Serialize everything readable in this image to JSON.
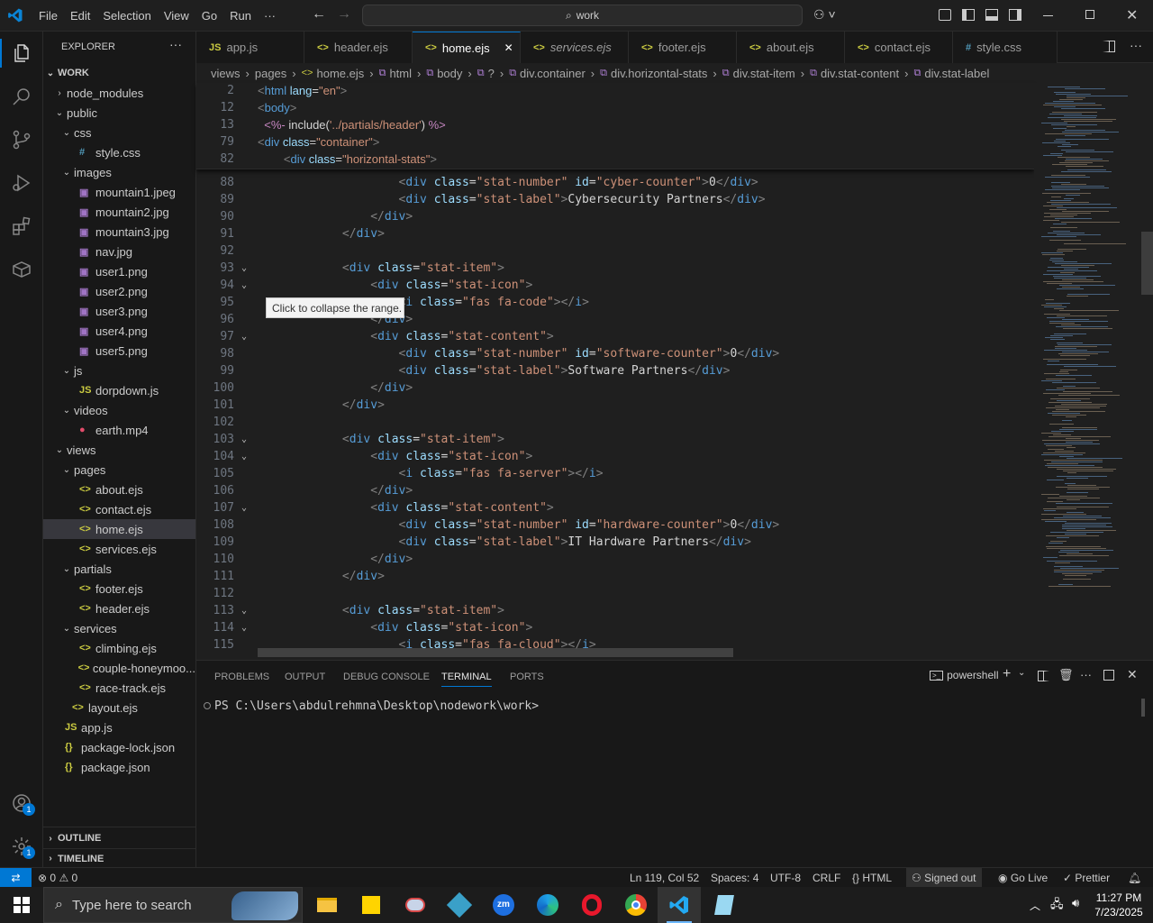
{
  "titlebar": {
    "menu": [
      "File",
      "Edit",
      "Selection",
      "View",
      "Go",
      "Run",
      "···"
    ],
    "search": "work"
  },
  "sidebar": {
    "title": "EXPLORER",
    "more": "···",
    "root": "WORK",
    "tree": [
      {
        "label": "node_modules",
        "indent": 1,
        "type": "folder",
        "open": false
      },
      {
        "label": "public",
        "indent": 1,
        "type": "folder",
        "open": true
      },
      {
        "label": "css",
        "indent": 2,
        "type": "folder",
        "open": true
      },
      {
        "label": "style.css",
        "indent": 3,
        "type": "css"
      },
      {
        "label": "images",
        "indent": 2,
        "type": "folder",
        "open": true
      },
      {
        "label": "mountain1.jpeg",
        "indent": 3,
        "type": "img"
      },
      {
        "label": "mountain2.jpg",
        "indent": 3,
        "type": "img"
      },
      {
        "label": "mountain3.jpg",
        "indent": 3,
        "type": "img"
      },
      {
        "label": "nav.jpg",
        "indent": 3,
        "type": "img"
      },
      {
        "label": "user1.png",
        "indent": 3,
        "type": "img"
      },
      {
        "label": "user2.png",
        "indent": 3,
        "type": "img"
      },
      {
        "label": "user3.png",
        "indent": 3,
        "type": "img"
      },
      {
        "label": "user4.png",
        "indent": 3,
        "type": "img"
      },
      {
        "label": "user5.png",
        "indent": 3,
        "type": "img"
      },
      {
        "label": "js",
        "indent": 2,
        "type": "folder",
        "open": true
      },
      {
        "label": "dorpdown.js",
        "indent": 3,
        "type": "js"
      },
      {
        "label": "videos",
        "indent": 2,
        "type": "folder",
        "open": true
      },
      {
        "label": "earth.mp4",
        "indent": 3,
        "type": "vid"
      },
      {
        "label": "views",
        "indent": 1,
        "type": "folder",
        "open": true
      },
      {
        "label": "pages",
        "indent": 2,
        "type": "folder",
        "open": true
      },
      {
        "label": "about.ejs",
        "indent": 3,
        "type": "ejs"
      },
      {
        "label": "contact.ejs",
        "indent": 3,
        "type": "ejs"
      },
      {
        "label": "home.ejs",
        "indent": 3,
        "type": "ejs",
        "selected": true
      },
      {
        "label": "services.ejs",
        "indent": 3,
        "type": "ejs"
      },
      {
        "label": "partials",
        "indent": 2,
        "type": "folder",
        "open": true
      },
      {
        "label": "footer.ejs",
        "indent": 3,
        "type": "ejs"
      },
      {
        "label": "header.ejs",
        "indent": 3,
        "type": "ejs"
      },
      {
        "label": "services",
        "indent": 2,
        "type": "folder",
        "open": true
      },
      {
        "label": "climbing.ejs",
        "indent": 3,
        "type": "ejs"
      },
      {
        "label": "couple-honeymoo...",
        "indent": 3,
        "type": "ejs"
      },
      {
        "label": "race-track.ejs",
        "indent": 3,
        "type": "ejs"
      },
      {
        "label": "layout.ejs",
        "indent": 2,
        "type": "ejs"
      },
      {
        "label": "app.js",
        "indent": 1,
        "type": "js"
      },
      {
        "label": "package-lock.json",
        "indent": 1,
        "type": "json"
      },
      {
        "label": "package.json",
        "indent": 1,
        "type": "json"
      }
    ],
    "outline": "OUTLINE",
    "timeline": "TIMELINE"
  },
  "tabs": [
    {
      "label": "app.js",
      "icon": "JS"
    },
    {
      "label": "header.ejs",
      "icon": "<>"
    },
    {
      "label": "home.ejs",
      "icon": "<>",
      "active": true,
      "close": "✕"
    },
    {
      "label": "services.ejs",
      "icon": "<>"
    },
    {
      "label": "footer.ejs",
      "icon": "<>"
    },
    {
      "label": "about.ejs",
      "icon": "<>"
    },
    {
      "label": "contact.ejs",
      "icon": "<>"
    },
    {
      "label": "style.css",
      "icon": "#"
    }
  ],
  "breadcrumb": [
    "views",
    "pages",
    "home.ejs",
    "html",
    "body",
    "?",
    "div.container",
    "div.horizontal-stats",
    "div.stat-item",
    "div.stat-content",
    "div.stat-label"
  ],
  "sticky": [
    {
      "n": "2",
      "html": "<span class='g'>&lt;</span><span class='t'>html</span> <span class='a'>lang</span>=<span class='s'>\"en\"</span><span class='g'>&gt;</span>"
    },
    {
      "n": "12",
      "html": "<span class='g'>&lt;</span><span class='t'>body</span><span class='g'>&gt;</span>"
    },
    {
      "n": "13",
      "html": "  <span class='e'>&lt;%-</span> include(<span class='s'>'../partials/header'</span>) <span class='e'>%&gt;</span>"
    },
    {
      "n": "79",
      "html": "<span class='g'>&lt;</span><span class='t'>div</span> <span class='a'>class</span>=<span class='s'>\"container\"</span><span class='g'>&gt;</span>"
    },
    {
      "n": "82",
      "html": "        <span class='g'>&lt;</span><span class='t'>div</span> <span class='a'>class</span>=<span class='s'>\"horizontal-stats\"</span><span class='g'>&gt;</span>"
    }
  ],
  "code": [
    {
      "n": "88",
      "html": "                    <span class='g'>&lt;</span><span class='t'>div</span> <span class='a'>class</span>=<span class='s'>\"stat-number\"</span> <span class='a'>id</span>=<span class='s'>\"cyber-counter\"</span><span class='g'>&gt;</span>0<span class='g'>&lt;/</span><span class='t'>div</span><span class='g'>&gt;</span>"
    },
    {
      "n": "89",
      "html": "                    <span class='g'>&lt;</span><span class='t'>div</span> <span class='a'>class</span>=<span class='s'>\"stat-label\"</span><span class='g'>&gt;</span>Cybersecurity Partners<span class='g'>&lt;/</span><span class='t'>div</span><span class='g'>&gt;</span>"
    },
    {
      "n": "90",
      "html": "                <span class='g'>&lt;/</span><span class='t'>div</span><span class='g'>&gt;</span>"
    },
    {
      "n": "91",
      "html": "            <span class='g'>&lt;/</span><span class='t'>div</span><span class='g'>&gt;</span>"
    },
    {
      "n": "92",
      "html": ""
    },
    {
      "n": "93",
      "fold": true,
      "html": "            <span class='g'>&lt;</span><span class='t'>div</span> <span class='a'>class</span>=<span class='s'>\"stat-item\"</span><span class='g'>&gt;</span>"
    },
    {
      "n": "94",
      "fold": true,
      "html": "                <span class='g'>&lt;</span><span class='t'>div</span> <span class='a'>class</span>=<span class='s'>\"stat-icon\"</span><span class='g'>&gt;</span>"
    },
    {
      "n": "95",
      "html": "                    <span class='g'>&lt;</span><span class='t'>i</span> <span class='a'>class</span>=<span class='s'>\"fas fa-code\"</span><span class='g'>&gt;&lt;/</span><span class='t'>i</span><span class='g'>&gt;</span>"
    },
    {
      "n": "96",
      "html": "                <span class='g'>&lt;/</span><span class='t'>div</span><span class='g'>&gt;</span>"
    },
    {
      "n": "97",
      "fold": true,
      "html": "                <span class='g'>&lt;</span><span class='t'>div</span> <span class='a'>class</span>=<span class='s'>\"stat-content\"</span><span class='g'>&gt;</span>"
    },
    {
      "n": "98",
      "html": "                    <span class='g'>&lt;</span><span class='t'>div</span> <span class='a'>class</span>=<span class='s'>\"stat-number\"</span> <span class='a'>id</span>=<span class='s'>\"software-counter\"</span><span class='g'>&gt;</span>0<span class='g'>&lt;/</span><span class='t'>div</span><span class='g'>&gt;</span>"
    },
    {
      "n": "99",
      "html": "                    <span class='g'>&lt;</span><span class='t'>div</span> <span class='a'>class</span>=<span class='s'>\"stat-label\"</span><span class='g'>&gt;</span>Software Partners<span class='g'>&lt;/</span><span class='t'>div</span><span class='g'>&gt;</span>"
    },
    {
      "n": "100",
      "html": "                <span class='g'>&lt;/</span><span class='t'>div</span><span class='g'>&gt;</span>"
    },
    {
      "n": "101",
      "html": "            <span class='g'>&lt;/</span><span class='t'>div</span><span class='g'>&gt;</span>"
    },
    {
      "n": "102",
      "html": ""
    },
    {
      "n": "103",
      "fold": true,
      "html": "            <span class='g'>&lt;</span><span class='t'>div</span> <span class='a'>class</span>=<span class='s'>\"stat-item\"</span><span class='g'>&gt;</span>"
    },
    {
      "n": "104",
      "fold": true,
      "html": "                <span class='g'>&lt;</span><span class='t'>div</span> <span class='a'>class</span>=<span class='s'>\"stat-icon\"</span><span class='g'>&gt;</span>"
    },
    {
      "n": "105",
      "html": "                    <span class='g'>&lt;</span><span class='t'>i</span> <span class='a'>class</span>=<span class='s'>\"fas fa-server\"</span><span class='g'>&gt;&lt;/</span><span class='t'>i</span><span class='g'>&gt;</span>"
    },
    {
      "n": "106",
      "html": "                <span class='g'>&lt;/</span><span class='t'>div</span><span class='g'>&gt;</span>"
    },
    {
      "n": "107",
      "fold": true,
      "html": "                <span class='g'>&lt;</span><span class='t'>div</span> <span class='a'>class</span>=<span class='s'>\"stat-content\"</span><span class='g'>&gt;</span>"
    },
    {
      "n": "108",
      "html": "                    <span class='g'>&lt;</span><span class='t'>div</span> <span class='a'>class</span>=<span class='s'>\"stat-number\"</span> <span class='a'>id</span>=<span class='s'>\"hardware-counter\"</span><span class='g'>&gt;</span>0<span class='g'>&lt;/</span><span class='t'>div</span><span class='g'>&gt;</span>"
    },
    {
      "n": "109",
      "html": "                    <span class='g'>&lt;</span><span class='t'>div</span> <span class='a'>class</span>=<span class='s'>\"stat-label\"</span><span class='g'>&gt;</span>IT Hardware Partners<span class='g'>&lt;/</span><span class='t'>div</span><span class='g'>&gt;</span>"
    },
    {
      "n": "110",
      "html": "                <span class='g'>&lt;/</span><span class='t'>div</span><span class='g'>&gt;</span>"
    },
    {
      "n": "111",
      "html": "            <span class='g'>&lt;/</span><span class='t'>div</span><span class='g'>&gt;</span>"
    },
    {
      "n": "112",
      "html": ""
    },
    {
      "n": "113",
      "fold": true,
      "html": "            <span class='g'>&lt;</span><span class='t'>div</span> <span class='a'>class</span>=<span class='s'>\"stat-item\"</span><span class='g'>&gt;</span>"
    },
    {
      "n": "114",
      "fold": true,
      "html": "                <span class='g'>&lt;</span><span class='t'>div</span> <span class='a'>class</span>=<span class='s'>\"stat-icon\"</span><span class='g'>&gt;</span>"
    },
    {
      "n": "115",
      "html": "                    <span class='g'>&lt;</span><span class='t'>i</span> <span class='a'>class</span>=<span class='s'>\"fas fa-cloud\"</span><span class='g'>&gt;&lt;/</span><span class='t'>i</span><span class='g'>&gt;</span>"
    }
  ],
  "tooltip": "Click to collapse the range.",
  "panel": {
    "tabs": [
      "PROBLEMS",
      "OUTPUT",
      "DEBUG CONSOLE",
      "TERMINAL",
      "PORTS"
    ],
    "active": "TERMINAL",
    "shell": "powershell",
    "prompt": "PS C:\\Users\\abdulrehmna\\Desktop\\nodework\\work>"
  },
  "status": {
    "errors": "0",
    "warnings": "0",
    "position": "Ln 119, Col 52",
    "spaces": "Spaces: 4",
    "encoding": "UTF-8",
    "eol": "CRLF",
    "language": "HTML",
    "account": "Signed out",
    "golive": "Go Live",
    "prettier": "Prettier"
  },
  "taskbar": {
    "search": "Type here to search",
    "time": "11:27 PM",
    "date": "7/23/2025"
  },
  "badges": {
    "account": "1",
    "settings": "1"
  },
  "colors": {
    "accent": "#0078d4",
    "status_remote": "#0078d4",
    "selection": "#37373d"
  }
}
